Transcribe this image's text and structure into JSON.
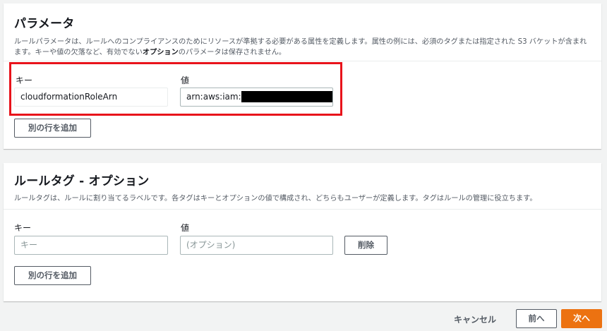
{
  "parameters": {
    "title": "パラメータ",
    "description_line1": "ルールパラメータは、ルールへのコンプライアンスのためにリソースが準拠する必要がある属性を定義します。属性の例には、必須のタグまたは指定された S3 バケットが含まれ",
    "description_line2_prefix": "ます。キーや値の欠落など、有効でない",
    "description_line2_bold": "オプション",
    "description_line2_suffix": "のパラメータは保存されません。",
    "key_label": "キー",
    "value_label": "値",
    "key_value": "cloudformationRoleArn",
    "value_value": "arn:aws:iam:",
    "add_row_label": "別の行を追加"
  },
  "tags": {
    "title": "ルールタグ - オプション",
    "description": "ルールタグは、ルールに割り当てるラベルです。各タグはキーとオプションの値で構成され、どちらもユーザーが定義します。タグはルールの管理に役立ちます。",
    "key_label": "キー",
    "value_label": "値",
    "key_placeholder": "キー",
    "value_placeholder": "(オプション)",
    "delete_label": "削除",
    "add_row_label": "別の行を追加"
  },
  "footer": {
    "cancel_label": "キャンセル",
    "previous_label": "前へ",
    "next_label": "次へ"
  },
  "colors": {
    "primary": "#ec7211",
    "highlight": "#e8131b"
  }
}
